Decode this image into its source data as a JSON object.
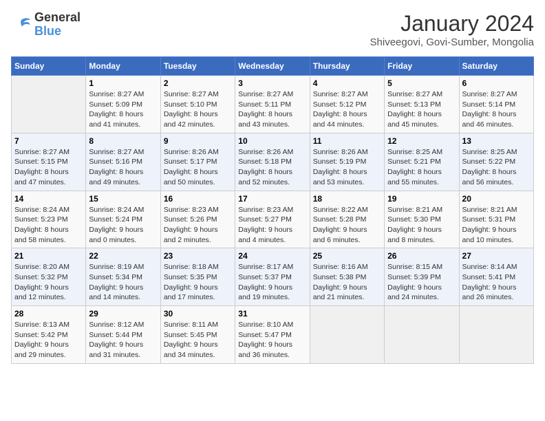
{
  "logo": {
    "line1": "General",
    "line2": "Blue"
  },
  "title": "January 2024",
  "subtitle": "Shiveegovi, Govi-Sumber, Mongolia",
  "days_of_week": [
    "Sunday",
    "Monday",
    "Tuesday",
    "Wednesday",
    "Thursday",
    "Friday",
    "Saturday"
  ],
  "weeks": [
    [
      {
        "day": "",
        "info": ""
      },
      {
        "day": "1",
        "info": "Sunrise: 8:27 AM\nSunset: 5:09 PM\nDaylight: 8 hours\nand 41 minutes."
      },
      {
        "day": "2",
        "info": "Sunrise: 8:27 AM\nSunset: 5:10 PM\nDaylight: 8 hours\nand 42 minutes."
      },
      {
        "day": "3",
        "info": "Sunrise: 8:27 AM\nSunset: 5:11 PM\nDaylight: 8 hours\nand 43 minutes."
      },
      {
        "day": "4",
        "info": "Sunrise: 8:27 AM\nSunset: 5:12 PM\nDaylight: 8 hours\nand 44 minutes."
      },
      {
        "day": "5",
        "info": "Sunrise: 8:27 AM\nSunset: 5:13 PM\nDaylight: 8 hours\nand 45 minutes."
      },
      {
        "day": "6",
        "info": "Sunrise: 8:27 AM\nSunset: 5:14 PM\nDaylight: 8 hours\nand 46 minutes."
      }
    ],
    [
      {
        "day": "7",
        "info": "Sunrise: 8:27 AM\nSunset: 5:15 PM\nDaylight: 8 hours\nand 47 minutes."
      },
      {
        "day": "8",
        "info": "Sunrise: 8:27 AM\nSunset: 5:16 PM\nDaylight: 8 hours\nand 49 minutes."
      },
      {
        "day": "9",
        "info": "Sunrise: 8:26 AM\nSunset: 5:17 PM\nDaylight: 8 hours\nand 50 minutes."
      },
      {
        "day": "10",
        "info": "Sunrise: 8:26 AM\nSunset: 5:18 PM\nDaylight: 8 hours\nand 52 minutes."
      },
      {
        "day": "11",
        "info": "Sunrise: 8:26 AM\nSunset: 5:19 PM\nDaylight: 8 hours\nand 53 minutes."
      },
      {
        "day": "12",
        "info": "Sunrise: 8:25 AM\nSunset: 5:21 PM\nDaylight: 8 hours\nand 55 minutes."
      },
      {
        "day": "13",
        "info": "Sunrise: 8:25 AM\nSunset: 5:22 PM\nDaylight: 8 hours\nand 56 minutes."
      }
    ],
    [
      {
        "day": "14",
        "info": "Sunrise: 8:24 AM\nSunset: 5:23 PM\nDaylight: 8 hours\nand 58 minutes."
      },
      {
        "day": "15",
        "info": "Sunrise: 8:24 AM\nSunset: 5:24 PM\nDaylight: 9 hours\nand 0 minutes."
      },
      {
        "day": "16",
        "info": "Sunrise: 8:23 AM\nSunset: 5:26 PM\nDaylight: 9 hours\nand 2 minutes."
      },
      {
        "day": "17",
        "info": "Sunrise: 8:23 AM\nSunset: 5:27 PM\nDaylight: 9 hours\nand 4 minutes."
      },
      {
        "day": "18",
        "info": "Sunrise: 8:22 AM\nSunset: 5:28 PM\nDaylight: 9 hours\nand 6 minutes."
      },
      {
        "day": "19",
        "info": "Sunrise: 8:21 AM\nSunset: 5:30 PM\nDaylight: 9 hours\nand 8 minutes."
      },
      {
        "day": "20",
        "info": "Sunrise: 8:21 AM\nSunset: 5:31 PM\nDaylight: 9 hours\nand 10 minutes."
      }
    ],
    [
      {
        "day": "21",
        "info": "Sunrise: 8:20 AM\nSunset: 5:32 PM\nDaylight: 9 hours\nand 12 minutes."
      },
      {
        "day": "22",
        "info": "Sunrise: 8:19 AM\nSunset: 5:34 PM\nDaylight: 9 hours\nand 14 minutes."
      },
      {
        "day": "23",
        "info": "Sunrise: 8:18 AM\nSunset: 5:35 PM\nDaylight: 9 hours\nand 17 minutes."
      },
      {
        "day": "24",
        "info": "Sunrise: 8:17 AM\nSunset: 5:37 PM\nDaylight: 9 hours\nand 19 minutes."
      },
      {
        "day": "25",
        "info": "Sunrise: 8:16 AM\nSunset: 5:38 PM\nDaylight: 9 hours\nand 21 minutes."
      },
      {
        "day": "26",
        "info": "Sunrise: 8:15 AM\nSunset: 5:39 PM\nDaylight: 9 hours\nand 24 minutes."
      },
      {
        "day": "27",
        "info": "Sunrise: 8:14 AM\nSunset: 5:41 PM\nDaylight: 9 hours\nand 26 minutes."
      }
    ],
    [
      {
        "day": "28",
        "info": "Sunrise: 8:13 AM\nSunset: 5:42 PM\nDaylight: 9 hours\nand 29 minutes."
      },
      {
        "day": "29",
        "info": "Sunrise: 8:12 AM\nSunset: 5:44 PM\nDaylight: 9 hours\nand 31 minutes."
      },
      {
        "day": "30",
        "info": "Sunrise: 8:11 AM\nSunset: 5:45 PM\nDaylight: 9 hours\nand 34 minutes."
      },
      {
        "day": "31",
        "info": "Sunrise: 8:10 AM\nSunset: 5:47 PM\nDaylight: 9 hours\nand 36 minutes."
      },
      {
        "day": "",
        "info": ""
      },
      {
        "day": "",
        "info": ""
      },
      {
        "day": "",
        "info": ""
      }
    ]
  ]
}
